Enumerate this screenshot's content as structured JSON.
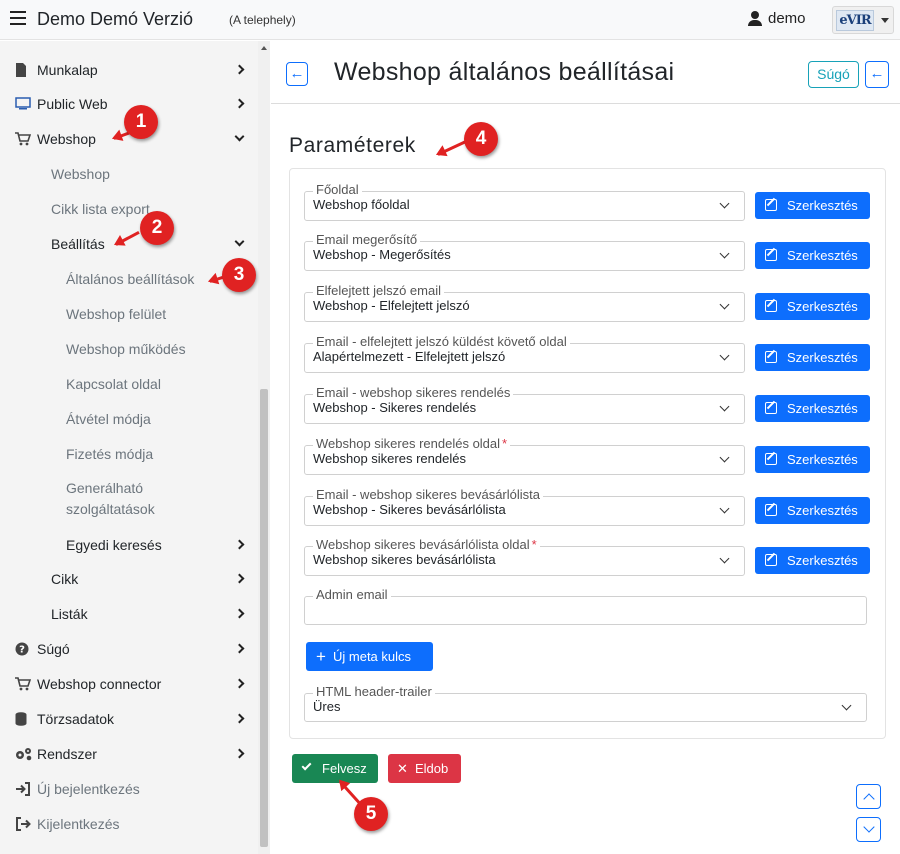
{
  "topbar": {
    "app_title": "Demo Demó Verzió",
    "app_subtitle": "(A telephely)",
    "user_name": "demo",
    "logo_text": "eVIR"
  },
  "sidebar": {
    "items": [
      {
        "label": "Munkalap",
        "icon": "file-icon"
      },
      {
        "label": "Public Web",
        "icon": "monitor-icon"
      },
      {
        "label": "Webshop",
        "icon": "cart-icon"
      },
      {
        "label": "Webshop"
      },
      {
        "label": "Cikk lista export"
      },
      {
        "label": "Beállítás"
      },
      {
        "label": "Általános beállítások"
      },
      {
        "label": "Webshop felület"
      },
      {
        "label": "Webshop működés"
      },
      {
        "label": "Kapcsolat oldal"
      },
      {
        "label": "Átvétel módja"
      },
      {
        "label": "Fizetés módja"
      },
      {
        "label": "Generálható szolgáltatások"
      },
      {
        "label": "Egyedi keresés"
      },
      {
        "label": "Cikk"
      },
      {
        "label": "Listák"
      },
      {
        "label": "Súgó",
        "icon": "question-circle-icon"
      },
      {
        "label": "Webshop connector",
        "icon": "cart-icon"
      },
      {
        "label": "Törzsadatok",
        "icon": "database-icon"
      },
      {
        "label": "Rendszer",
        "icon": "gears-icon"
      },
      {
        "label": "Új bejelentkezés",
        "icon": "sign-in-icon"
      },
      {
        "label": "Kijelentkezés",
        "icon": "sign-out-icon"
      }
    ]
  },
  "main": {
    "title": "Webshop általános beállításai",
    "help_label": "Súgó",
    "section_title": "Paraméterek",
    "fields": [
      {
        "legend": "Főoldal",
        "value": "Webshop főoldal",
        "required": false
      },
      {
        "legend": "Email megerősítő",
        "value": "Webshop - Megerősítés",
        "required": false
      },
      {
        "legend": "Elfelejtett jelszó email",
        "value": "Webshop - Elfelejtett jelszó",
        "required": false
      },
      {
        "legend": "Email - elfelejtett jelszó küldést követő oldal",
        "value": "Alapértelmezett - Elfelejtett jelszó",
        "required": false
      },
      {
        "legend": "Email - webshop sikeres rendelés",
        "value": "Webshop - Sikeres rendelés",
        "required": false
      },
      {
        "legend": "Webshop sikeres rendelés oldal",
        "value": "Webshop sikeres rendelés",
        "required": true
      },
      {
        "legend": "Email - webshop sikeres bevásárlólista",
        "value": "Webshop - Sikeres bevásárlólista",
        "required": false
      },
      {
        "legend": "Webshop sikeres bevásárlólista oldal",
        "value": "Webshop sikeres bevásárlólista",
        "required": true
      }
    ],
    "edit_label": "Szerkesztés",
    "admin_email": {
      "legend": "Admin email",
      "value": ""
    },
    "new_meta_label": "Új meta kulcs",
    "html_header": {
      "legend": "HTML header-trailer",
      "value": "Üres"
    },
    "save_label": "Felvesz",
    "discard_label": "Eldob"
  },
  "callouts": [
    "1",
    "2",
    "3",
    "4",
    "5"
  ],
  "colors": {
    "primary": "#0d6efd",
    "success": "#198754",
    "danger": "#dc3545",
    "info": "#17a2b8",
    "callout": "#e02222"
  }
}
